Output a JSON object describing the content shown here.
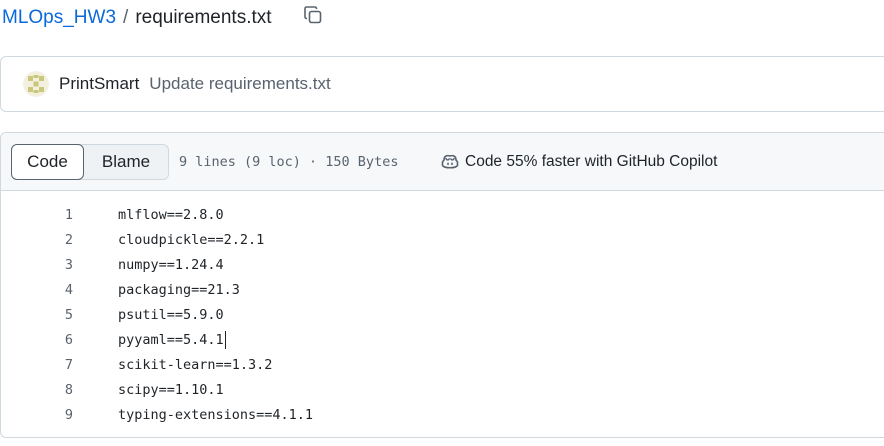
{
  "breadcrumb": {
    "repo": "MLOps_HW3",
    "separator": "/",
    "file": "requirements.txt"
  },
  "commit": {
    "author": "PrintSmart",
    "message": "Update requirements.txt"
  },
  "file_header": {
    "tabs": [
      "Code",
      "Blame"
    ],
    "active_tab": "Code",
    "stats": "9 lines (9 loc) · 150 Bytes",
    "copilot": "Code 55% faster with GitHub Copilot"
  },
  "code": {
    "lines": [
      {
        "num": "1",
        "text": "mlflow==2.8.0"
      },
      {
        "num": "2",
        "text": "cloudpickle==2.2.1"
      },
      {
        "num": "3",
        "text": "numpy==1.24.4"
      },
      {
        "num": "4",
        "text": "packaging==21.3"
      },
      {
        "num": "5",
        "text": "psutil==5.9.0"
      },
      {
        "num": "6",
        "text": "pyyaml==5.4.1"
      },
      {
        "num": "7",
        "text": "scikit-learn==1.3.2"
      },
      {
        "num": "8",
        "text": "scipy==1.10.1"
      },
      {
        "num": "9",
        "text": "typing-extensions==4.1.1"
      }
    ],
    "cursor_line": "6"
  },
  "icons": {
    "copy": "copy-icon",
    "avatar": "identicon-avatar",
    "copilot": "copilot-icon"
  },
  "colors": {
    "link": "#0969da",
    "muted": "#59636e",
    "border": "#d1d9e0",
    "header_bg": "#f6f8fa",
    "avatar": "#c9c87a"
  }
}
